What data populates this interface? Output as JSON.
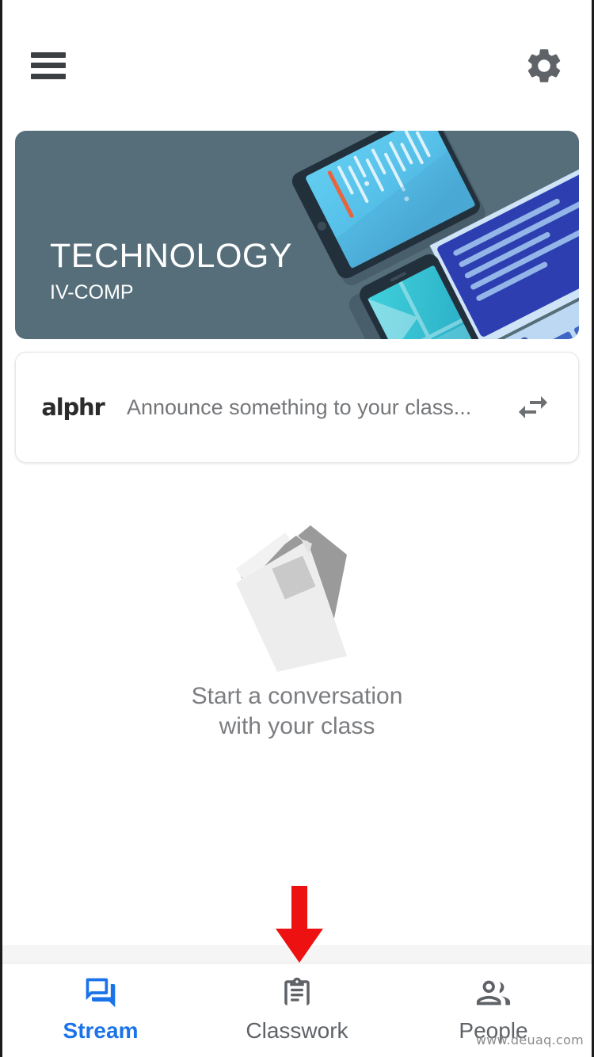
{
  "appbar": {
    "menu_icon": "hamburger-menu-icon",
    "settings_icon": "gear-icon"
  },
  "banner": {
    "class_name": "TECHNOLOGY",
    "class_section": "IV-COMP",
    "background_color": "#566e7a"
  },
  "announce": {
    "avatar_label": "alphr",
    "placeholder": "Announce something to your class...",
    "action_icon": "swap-arrows-icon"
  },
  "empty_state": {
    "illustration": "stacked-papers-illustration",
    "line1": "Start a conversation",
    "line2": "with your class"
  },
  "annotation": {
    "arrow_icon": "red-down-arrow",
    "arrow_color": "#ee1111"
  },
  "bottom_nav": {
    "active_color": "#1a73e8",
    "inactive_color": "#5f6368",
    "items": [
      {
        "label": "Stream",
        "icon": "forum-icon",
        "active": true
      },
      {
        "label": "Classwork",
        "icon": "clipboard-icon",
        "active": false
      },
      {
        "label": "People",
        "icon": "people-icon",
        "active": false
      }
    ]
  },
  "watermark": {
    "text": "www.deuaq.com"
  }
}
